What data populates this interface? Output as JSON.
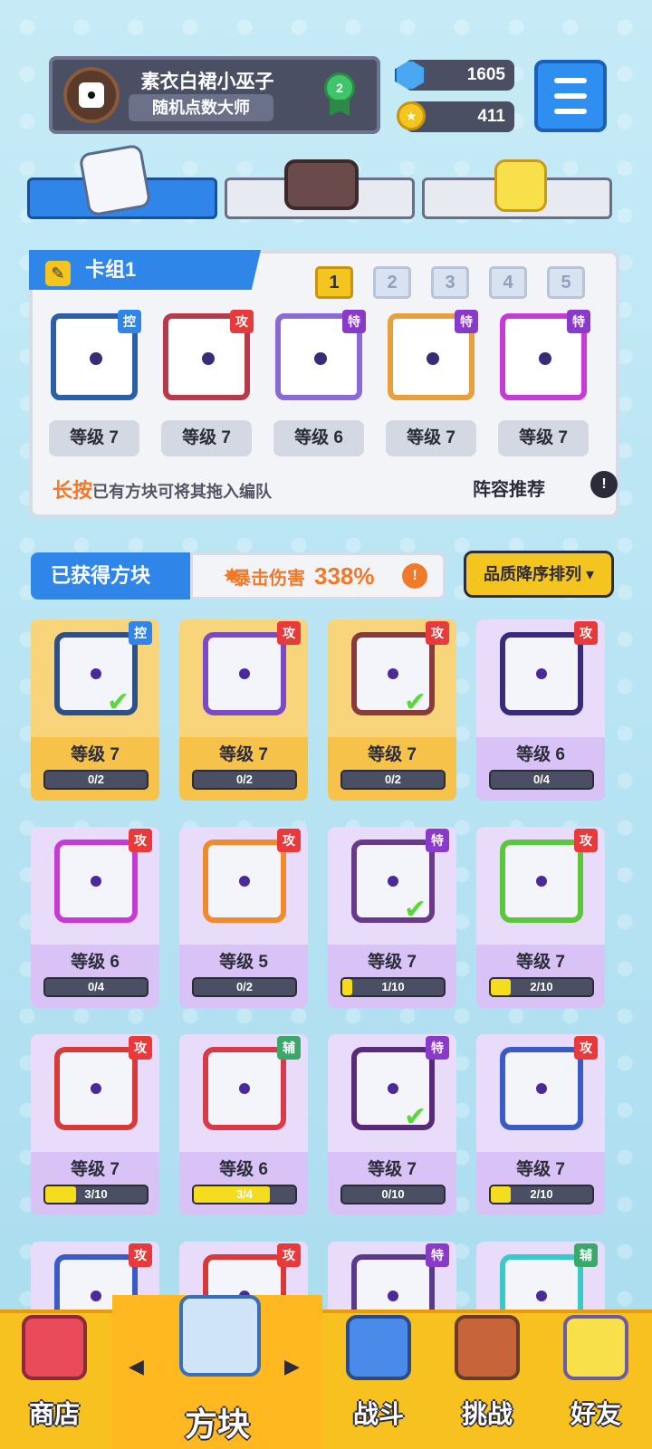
{
  "profile": {
    "name": "素衣白裙小巫子",
    "title": "随机点数大师",
    "rank": "2"
  },
  "resources": {
    "gems": "1605",
    "coins": "411"
  },
  "deck": {
    "title": "卡组1",
    "pages": [
      "1",
      "2",
      "3",
      "4",
      "5"
    ],
    "active_page": "1",
    "slots": [
      {
        "tag": "控",
        "tag_color": "#2f86e8",
        "level": "等级 7",
        "border": "#2d5fa8"
      },
      {
        "tag": "攻",
        "tag_color": "#e83a3a",
        "level": "等级 7",
        "border": "#b83a4a"
      },
      {
        "tag": "特",
        "tag_color": "#8a3ac8",
        "level": "等级 6",
        "border": "#8a6ad8"
      },
      {
        "tag": "特",
        "tag_color": "#8a3ac8",
        "level": "等级 7",
        "border": "#e8a03a"
      },
      {
        "tag": "特",
        "tag_color": "#8a3ac8",
        "level": "等级 7",
        "border": "#c83ad8"
      }
    ],
    "hint_key": "长按",
    "hint_rest": "已有方块可将其拖入编队",
    "recommend": "阵容推荐"
  },
  "owned": {
    "title": "已获得方块",
    "crit_label": "暴击伤害",
    "crit_value": "338%",
    "sort": "品质降序排列 ▾"
  },
  "cards": [
    {
      "tag": "控",
      "tag_color": "#2f86e8",
      "level": "等级 7",
      "progress": "0/2",
      "fill": 0,
      "gold": true,
      "border": "#2d4f8a",
      "check": true
    },
    {
      "tag": "攻",
      "tag_color": "#e83a3a",
      "level": "等级 7",
      "progress": "0/2",
      "fill": 0,
      "gold": true,
      "border": "#7a4ac8",
      "check": false
    },
    {
      "tag": "攻",
      "tag_color": "#e83a3a",
      "level": "等级 7",
      "progress": "0/2",
      "fill": 0,
      "gold": true,
      "border": "#8a3a3a",
      "check": true
    },
    {
      "tag": "攻",
      "tag_color": "#e83a3a",
      "level": "等级 6",
      "progress": "0/4",
      "fill": 0,
      "gold": false,
      "border": "#3a2a7a",
      "check": false
    },
    {
      "tag": "攻",
      "tag_color": "#e83a3a",
      "level": "等级 6",
      "progress": "0/4",
      "fill": 0,
      "gold": false,
      "border": "#c83ad8",
      "check": false
    },
    {
      "tag": "攻",
      "tag_color": "#e83a3a",
      "level": "等级 5",
      "progress": "0/2",
      "fill": 0,
      "gold": false,
      "border": "#f08a2a",
      "check": false
    },
    {
      "tag": "特",
      "tag_color": "#8a3ac8",
      "level": "等级 7",
      "progress": "1/10",
      "fill": 0.1,
      "gold": false,
      "border": "#6a3a8a",
      "check": true
    },
    {
      "tag": "攻",
      "tag_color": "#e83a3a",
      "level": "等级 7",
      "progress": "2/10",
      "fill": 0.2,
      "gold": false,
      "border": "#5ac83a",
      "check": false
    },
    {
      "tag": "攻",
      "tag_color": "#e83a3a",
      "level": "等级 7",
      "progress": "3/10",
      "fill": 0.3,
      "gold": false,
      "border": "#d83a3a",
      "check": false
    },
    {
      "tag": "辅",
      "tag_color": "#3aa86a",
      "level": "等级 6",
      "progress": "3/4",
      "fill": 0.75,
      "gold": false,
      "border": "#d83a4a",
      "check": false
    },
    {
      "tag": "特",
      "tag_color": "#8a3ac8",
      "level": "等级 7",
      "progress": "0/10",
      "fill": 0,
      "gold": false,
      "border": "#5a2a7a",
      "check": true
    },
    {
      "tag": "攻",
      "tag_color": "#e83a3a",
      "level": "等级 7",
      "progress": "2/10",
      "fill": 0.2,
      "gold": false,
      "border": "#3a5ac8",
      "check": false
    },
    {
      "tag": "攻",
      "tag_color": "#e83a3a",
      "level": "",
      "progress": "",
      "fill": 0,
      "gold": false,
      "border": "#3a5ac8",
      "check": false
    },
    {
      "tag": "攻",
      "tag_color": "#e83a3a",
      "level": "",
      "progress": "",
      "fill": 0,
      "gold": false,
      "border": "#d83a3a",
      "check": false
    },
    {
      "tag": "特",
      "tag_color": "#8a3ac8",
      "level": "",
      "progress": "",
      "fill": 0,
      "gold": false,
      "border": "#5a3a8a",
      "check": false
    },
    {
      "tag": "辅",
      "tag_color": "#3aa86a",
      "level": "",
      "progress": "",
      "fill": 0,
      "gold": false,
      "border": "#3ac8c8",
      "check": false
    }
  ],
  "nav": {
    "shop": "商店",
    "blocks": "方块",
    "battle": "战斗",
    "challenge": "挑战",
    "friends": "好友"
  }
}
